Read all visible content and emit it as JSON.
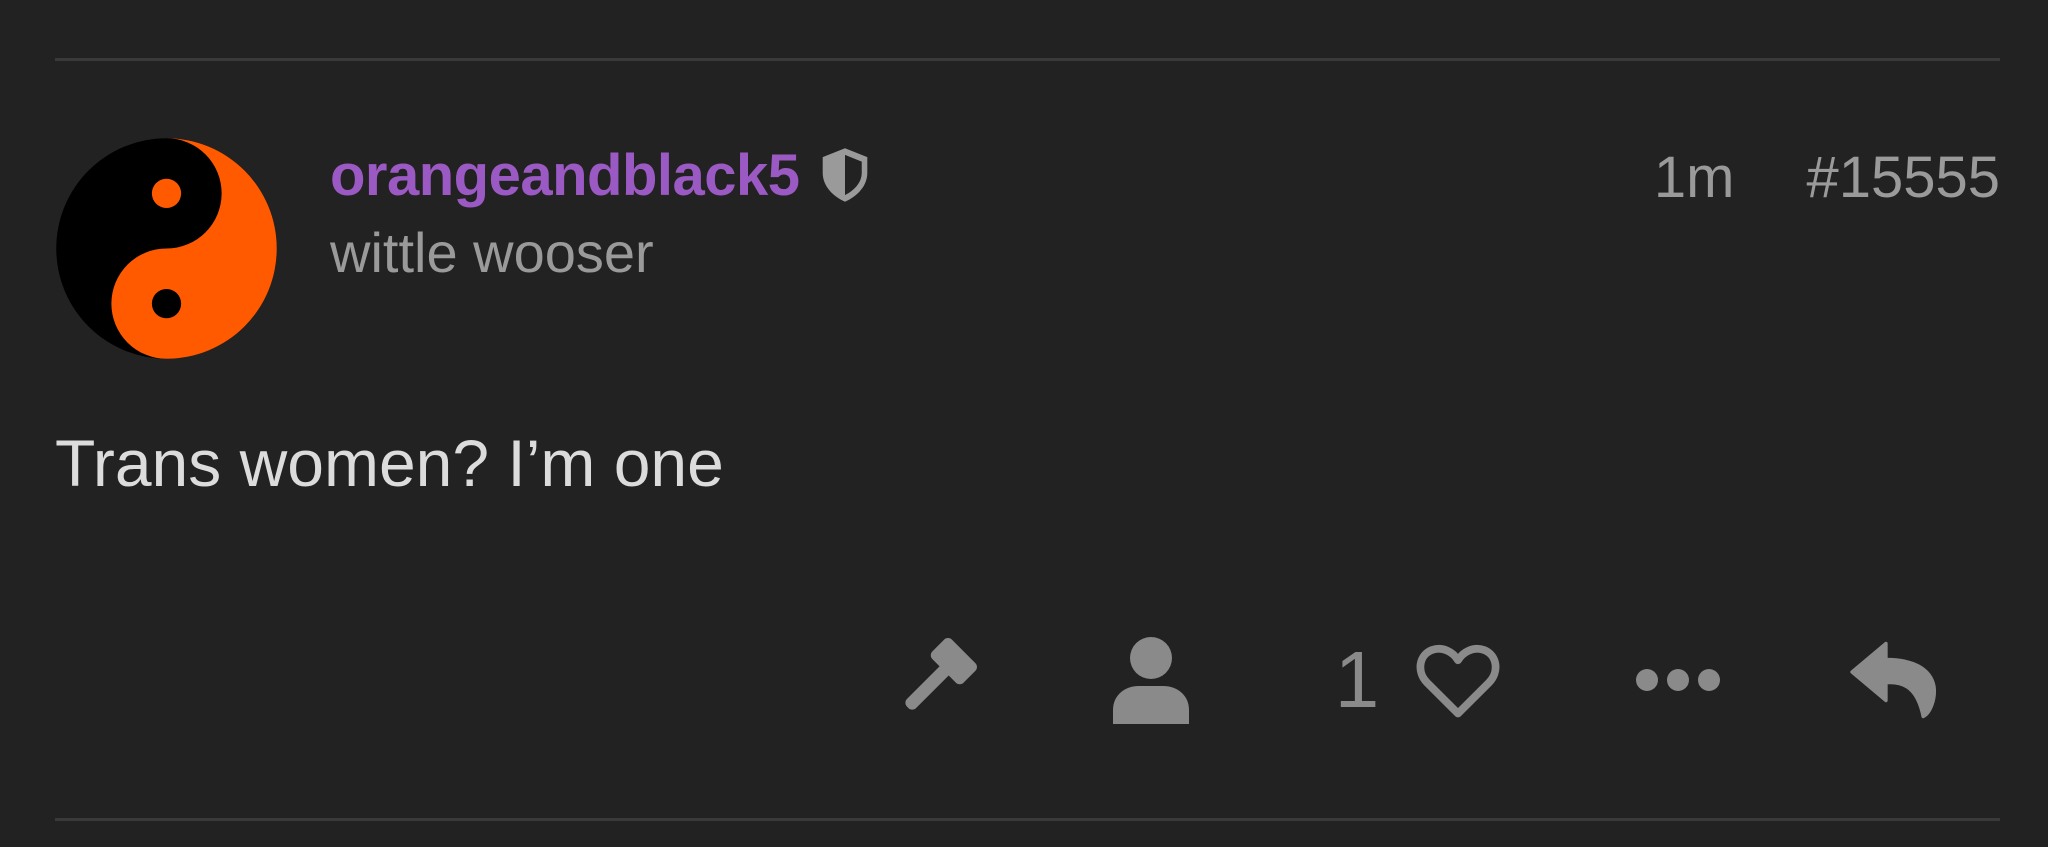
{
  "post": {
    "username": "orangeandblack5",
    "user_title": "wittle wooser",
    "time_ago": "1m",
    "post_number": "#15555",
    "body": "Trans women? I’m one",
    "like_count": "1"
  },
  "colors": {
    "background": "#222222",
    "username": "#9b59c4",
    "muted_text": "#9a9a9a",
    "body_text": "#dcdcdc",
    "icon": "#8a8a8a",
    "avatar_orange": "#ff5a00",
    "avatar_black": "#000000"
  },
  "icons": {
    "badge": "shield-icon",
    "moderate": "gavel-icon",
    "profile": "user-icon",
    "like": "heart-icon",
    "more": "ellipsis-icon",
    "reply": "reply-icon"
  }
}
